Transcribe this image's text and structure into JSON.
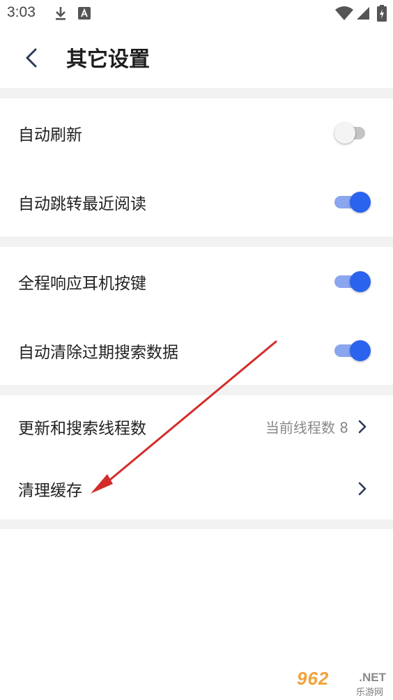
{
  "status_bar": {
    "time": "3:03",
    "left_icons": [
      "download-icon",
      "font-a-icon"
    ],
    "right_icons": [
      "wifi-icon",
      "signal-icon",
      "battery-icon"
    ]
  },
  "app_bar": {
    "back_icon": "back-chevron-icon",
    "title": "其它设置"
  },
  "settings": [
    {
      "label": "自动刷新",
      "type": "toggle",
      "on": false
    },
    {
      "label": "自动跳转最近阅读",
      "type": "toggle",
      "on": true
    },
    {
      "label": "全程响应耳机按键",
      "type": "toggle",
      "on": true
    },
    {
      "label": "自动清除过期搜索数据",
      "type": "toggle",
      "on": true
    },
    {
      "label": "更新和搜索线程数",
      "type": "nav",
      "value": "当前线程数 8"
    },
    {
      "label": "清理缓存",
      "type": "nav",
      "value": ""
    }
  ],
  "colors": {
    "accent": "#2a63ee",
    "accent_track": "#8aa6ee",
    "off_track": "#c4c4c4",
    "divider": "#f2f2f2",
    "annotation_arrow": "#d42b2b"
  },
  "watermark": {
    "main": "962",
    "suffix": ".NET",
    "sub": "乐游网"
  }
}
